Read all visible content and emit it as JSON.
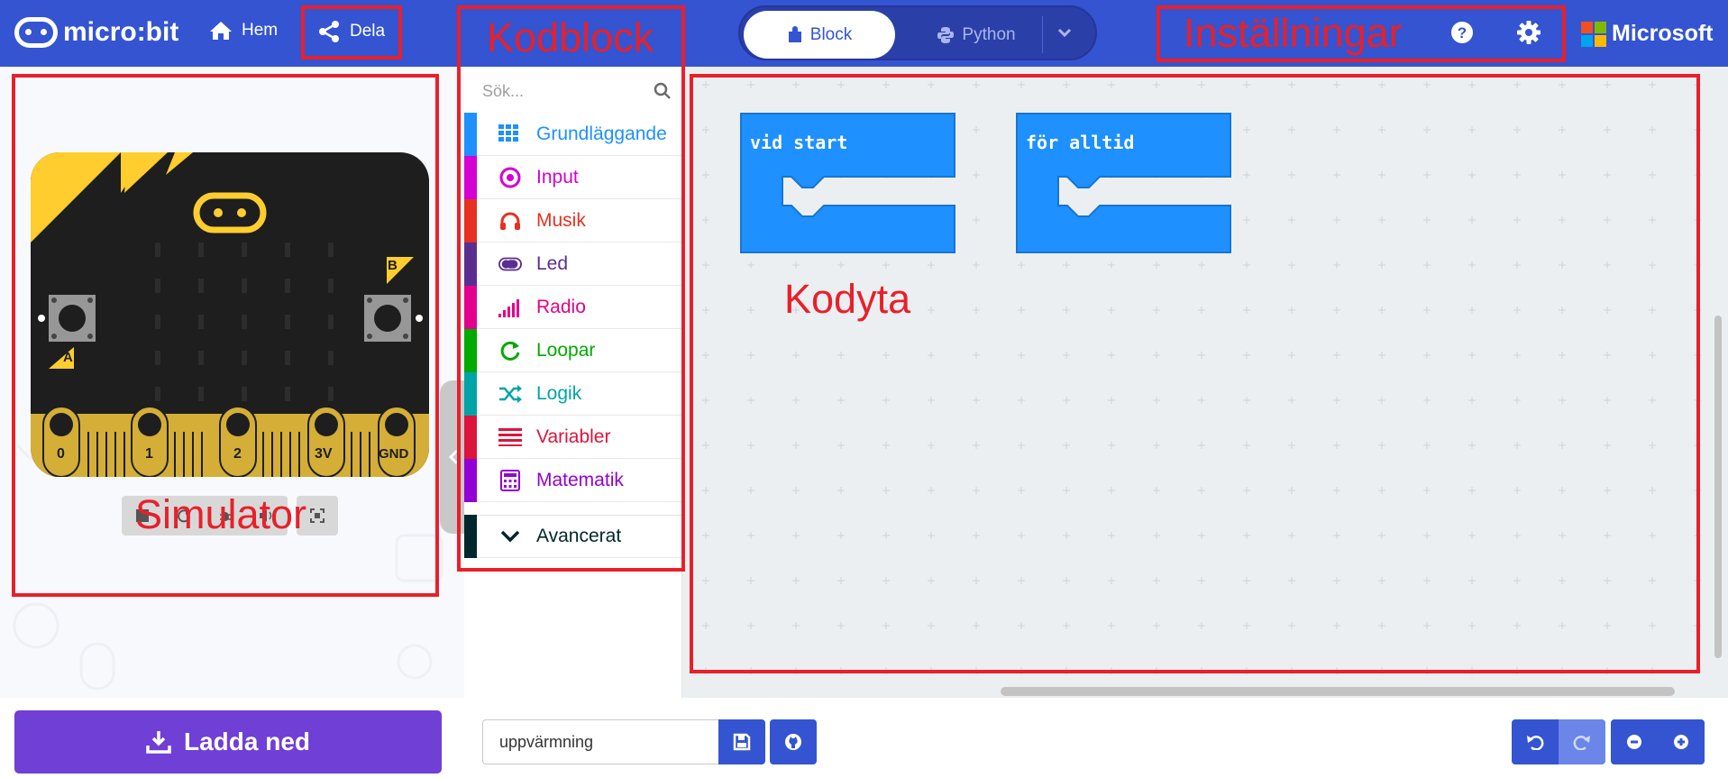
{
  "header": {
    "brand": "micro:bit",
    "home_label": "Hem",
    "share_label": "Dela",
    "mode_block": "Block",
    "mode_python": "Python",
    "microsoft": "Microsoft"
  },
  "annotations": {
    "kodblock": "Kodblock",
    "installningar": "Inställningar",
    "simulator": "Simulator",
    "kodyta": "Kodyta"
  },
  "simulator": {
    "pins": [
      "0",
      "1",
      "2",
      "3V",
      "GND"
    ],
    "button_a": "A",
    "button_b": "B"
  },
  "toolbox": {
    "search_placeholder": "Sök...",
    "categories": [
      {
        "label": "Grundläggande",
        "color": "#1e90ff"
      },
      {
        "label": "Input",
        "color": "#d400d4"
      },
      {
        "label": "Musik",
        "color": "#e63022"
      },
      {
        "label": "Led",
        "color": "#5c2d91"
      },
      {
        "label": "Radio",
        "color": "#e3008c"
      },
      {
        "label": "Loopar",
        "color": "#00aa00"
      },
      {
        "label": "Logik",
        "color": "#00a4a6"
      },
      {
        "label": "Variabler",
        "color": "#dc143c"
      },
      {
        "label": "Matematik",
        "color": "#9400d3"
      },
      {
        "label": "Avancerat",
        "color": "#00272b"
      }
    ]
  },
  "workspace": {
    "blocks": [
      {
        "label": "vid start"
      },
      {
        "label": "för alltid"
      }
    ]
  },
  "footer": {
    "download_label": "Ladda ned",
    "project_name": "uppvärmning"
  },
  "colors": {
    "header": "#3454d1",
    "accent": "#6f3fd6",
    "annotation": "#e8202a",
    "block": "#1e90ff"
  }
}
